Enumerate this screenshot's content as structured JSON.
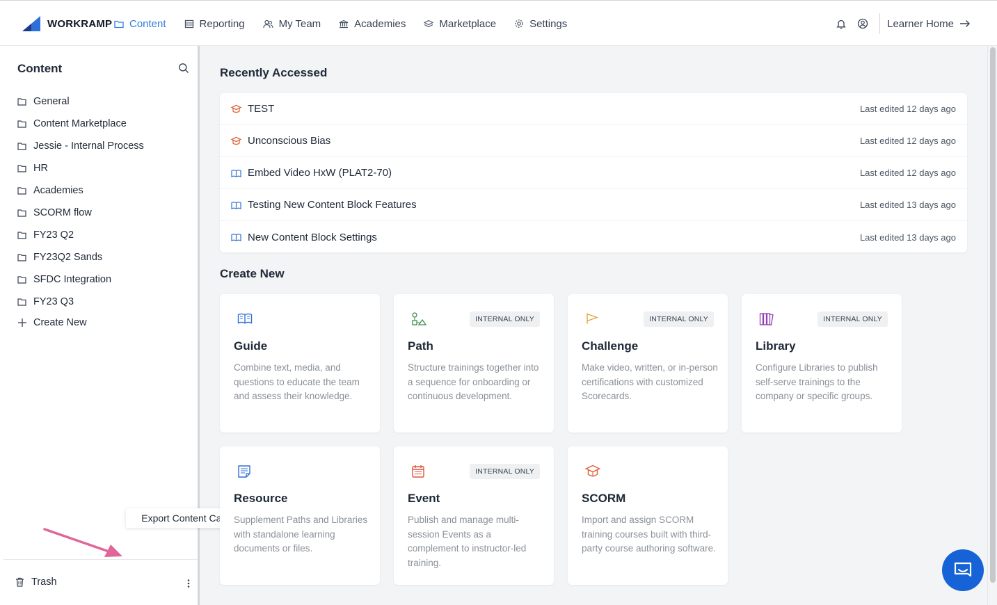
{
  "brand": {
    "name": "WORKRAMP"
  },
  "nav": {
    "items": [
      {
        "label": "Content",
        "icon": "folder-icon",
        "active": true
      },
      {
        "label": "Reporting",
        "icon": "report-icon"
      },
      {
        "label": "My Team",
        "icon": "team-icon"
      },
      {
        "label": "Academies",
        "icon": "academy-icon"
      },
      {
        "label": "Marketplace",
        "icon": "layers-icon"
      },
      {
        "label": "Settings",
        "icon": "gear-icon"
      }
    ],
    "learner_home": "Learner Home"
  },
  "sidebar": {
    "title": "Content",
    "folders": [
      "General",
      "Content Marketplace",
      "Jessie - Internal Process",
      "HR",
      "Academies",
      "SCORM flow",
      "FY23 Q2",
      "FY23Q2 Sands",
      "SFDC Integration",
      "FY23 Q3"
    ],
    "create_new": "Create New",
    "trash": "Trash",
    "tooltip": "Export Content Catalog"
  },
  "recent": {
    "title": "Recently Accessed",
    "items": [
      {
        "name": "TEST",
        "meta": "Last edited 12 days ago",
        "icon": "scorm-icon"
      },
      {
        "name": "Unconscious Bias",
        "meta": "Last edited 12 days ago",
        "icon": "scorm-icon"
      },
      {
        "name": "Embed Video HxW (PLAT2-70)",
        "meta": "Last edited 12 days ago",
        "icon": "guide-icon"
      },
      {
        "name": "Testing New Content Block Features",
        "meta": "Last edited 13 days ago",
        "icon": "guide-icon"
      },
      {
        "name": "New Content Block Settings",
        "meta": "Last edited 13 days ago",
        "icon": "guide-icon"
      }
    ]
  },
  "create": {
    "title": "Create New",
    "cards": [
      {
        "title": "Guide",
        "badge": "",
        "desc": "Combine text, media, and questions to educate the team and assess their knowledge."
      },
      {
        "title": "Path",
        "badge": "INTERNAL ONLY",
        "desc": "Structure trainings together into a sequence for onboarding or continuous development."
      },
      {
        "title": "Challenge",
        "badge": "INTERNAL ONLY",
        "desc": "Make video, written, or in-person certifications with customized Scorecards."
      },
      {
        "title": "Library",
        "badge": "INTERNAL ONLY",
        "desc": "Configure Libraries to publish self-serve trainings to the company or specific groups."
      },
      {
        "title": "Resource",
        "badge": "",
        "desc": "Supplement Paths and Libraries with standalone learning documents or files."
      },
      {
        "title": "Event",
        "badge": "INTERNAL ONLY",
        "desc": "Publish and manage multi-session Events as a complement to instructor-led training."
      },
      {
        "title": "SCORM",
        "badge": "",
        "desc": "Import and assign SCORM training courses built with third-party course authoring software."
      }
    ]
  },
  "colors": {
    "accent": "#2f7de1",
    "chat": "#1563d6",
    "arrow": "#e0669a",
    "scorm": "#e0623a"
  }
}
